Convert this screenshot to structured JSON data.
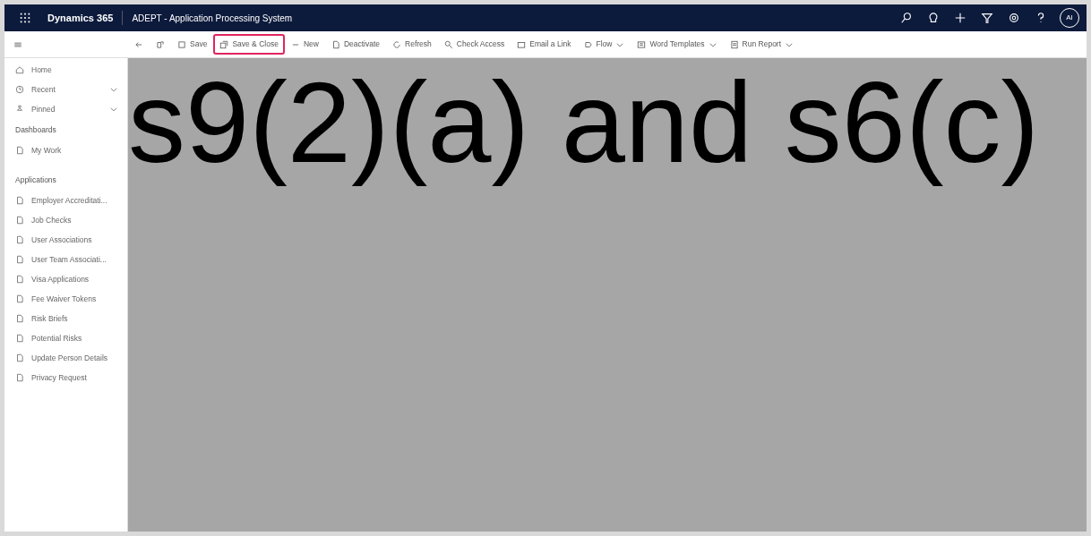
{
  "top_bar": {
    "app_name": "Dynamics 365",
    "title": "ADEPT - Application Processing System",
    "avatar": "AI"
  },
  "toolbar": [
    {
      "label": "Save",
      "highlighted": false,
      "has_menu": false
    },
    {
      "label": "Save & Close",
      "highlighted": true,
      "has_menu": false
    },
    {
      "label": "New",
      "highlighted": false,
      "has_menu": false
    },
    {
      "label": "Deactivate",
      "highlighted": false,
      "has_menu": false
    },
    {
      "label": "Refresh",
      "highlighted": false,
      "has_menu": false
    },
    {
      "label": "Check Access",
      "highlighted": false,
      "has_menu": false
    },
    {
      "label": "Email a Link",
      "highlighted": false,
      "has_menu": false
    },
    {
      "label": "Flow",
      "highlighted": false,
      "has_menu": true
    },
    {
      "label": "Word Templates",
      "highlighted": false,
      "has_menu": true
    },
    {
      "label": "Run Report",
      "highlighted": false,
      "has_menu": true
    }
  ],
  "sidebar": {
    "items": [
      {
        "label": "Home",
        "expandable": false
      },
      {
        "label": "Recent",
        "expandable": true
      },
      {
        "label": "Pinned",
        "expandable": true
      }
    ],
    "sections": [
      {
        "title": "Dashboards",
        "items": [
          {
            "label": "My Work"
          }
        ]
      },
      {
        "title": "Applications",
        "items": [
          {
            "label": "Employer Accreditati..."
          },
          {
            "label": "Job Checks"
          },
          {
            "label": "User Associations"
          },
          {
            "label": "User Team Associati..."
          },
          {
            "label": "Visa Applications"
          },
          {
            "label": "Fee Waiver Tokens"
          },
          {
            "label": "Risk Briefs"
          },
          {
            "label": "Potential Risks"
          },
          {
            "label": "Update Person Details"
          },
          {
            "label": "Privacy Request"
          }
        ]
      }
    ]
  },
  "redaction": {
    "text": "s9(2)(a) and s6(c)"
  }
}
